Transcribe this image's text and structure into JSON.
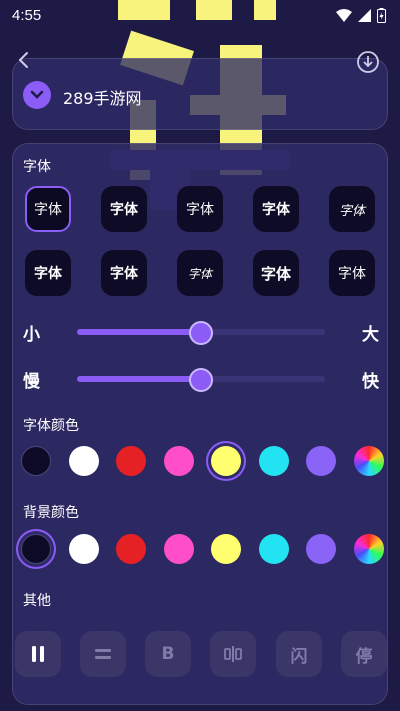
{
  "status": {
    "time": "4:55"
  },
  "search": {
    "site_name": "289手游网"
  },
  "panel": {
    "font_section_title": "字体",
    "font_tiles": [
      "字体",
      "字体",
      "字体",
      "字体",
      "字体",
      "字体",
      "字体",
      "字体",
      "字体",
      "字体"
    ],
    "selected_font_index": 0,
    "size_slider": {
      "min_label": "小",
      "max_label": "大",
      "value_percent": 50
    },
    "speed_slider": {
      "min_label": "慢",
      "max_label": "快",
      "value_percent": 50
    },
    "font_color_title": "字体颜色",
    "font_colors": [
      "#0d0b25",
      "#ffffff",
      "#e52125",
      "#ff4fc8",
      "#ffff70",
      "#22e3f2",
      "#8a63f7",
      "rainbow"
    ],
    "selected_font_color_index": 4,
    "bg_color_title": "背景颜色",
    "bg_colors": [
      "#0d0b25",
      "#ffffff",
      "#e52125",
      "#ff4fc8",
      "#ffff70",
      "#22e3f2",
      "#8a63f7",
      "rainbow"
    ],
    "selected_bg_color_index": 0,
    "other_title": "其他",
    "actions": [
      {
        "icon": "pause-icon",
        "label": "",
        "active": true
      },
      {
        "icon": "equal-icon",
        "label": "",
        "active": false
      },
      {
        "icon": "bold-icon",
        "label": "B",
        "active": false
      },
      {
        "icon": "mirror-icon",
        "label": "",
        "active": false
      },
      {
        "icon": "flash-icon",
        "label": "闪",
        "active": false
      },
      {
        "icon": "stop-icon",
        "label": "停",
        "active": false
      }
    ]
  },
  "colors": {
    "accent": "#8b5cf6",
    "background": "#1d1a45",
    "panel": "#2f2b68",
    "highlight_text": "#f7f37d"
  }
}
